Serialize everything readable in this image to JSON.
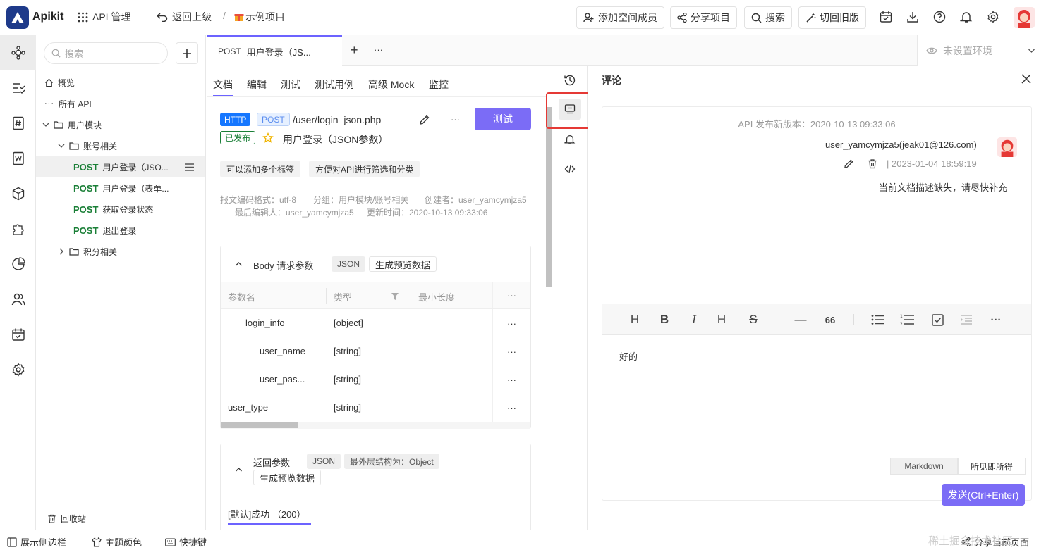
{
  "app": {
    "name": "Apikit",
    "api_manage": "API 管理",
    "back": "返回上级",
    "separator": "/",
    "project": "示例项目"
  },
  "top_actions": {
    "add_member": "添加空间成员",
    "share_project": "分享项目",
    "search": "搜索",
    "switch_old": "切回旧版"
  },
  "sidebar": {
    "search_placeholder": "搜索",
    "overview": "概览",
    "all_api": "所有 API",
    "user_module": "用户模块",
    "account": "账号相关",
    "apis": [
      {
        "method": "POST",
        "name": "用户登录（JSO..."
      },
      {
        "method": "POST",
        "name": "用户登录（表单..."
      },
      {
        "method": "POST",
        "name": "获取登录状态"
      },
      {
        "method": "POST",
        "name": "退出登录"
      }
    ],
    "points": "积分相关",
    "recycle": "回收站"
  },
  "bottom": {
    "show_sidebar": "展示侧边栏",
    "theme": "主题颜色",
    "shortcuts": "快捷键",
    "share_page": "分享当前页面"
  },
  "watermark": "稀土掘金技术社区",
  "tab": {
    "method": "POST",
    "title": "用户登录（JS...",
    "add": "+",
    "more": "···"
  },
  "env": {
    "label": "未设置环境"
  },
  "doc": {
    "subtabs": [
      "文档",
      "编辑",
      "测试",
      "测试用例",
      "高级 Mock",
      "监控"
    ],
    "protocol": "HTTP",
    "method": "POST",
    "path": "/user/login_json.php",
    "test_button": "测试",
    "status": "已发布",
    "name": "用户登录（JSON参数）",
    "tags": [
      "可以添加多个标签",
      "方便对API进行筛选和分类"
    ],
    "meta": {
      "encoding": "报文编码格式：utf-8",
      "group": "分组：用户模块/账号相关",
      "creator": "创建者：user_yamcymjza5",
      "editor": "最后编辑人：user_yamcymjza5",
      "updated": "更新时间：2020-10-13 09:33:06"
    },
    "body": {
      "title": "Body 请求参数",
      "type": "JSON",
      "preview": "生成预览数据",
      "headers": [
        "参数名",
        "类型",
        "最小长度"
      ],
      "rows": [
        {
          "name": "login_info",
          "type": "[object]"
        },
        {
          "name": "user_name",
          "type": "[string]"
        },
        {
          "name": "user_pas...",
          "type": "[string]"
        },
        {
          "name": "user_type",
          "type": "[string]"
        }
      ]
    },
    "response": {
      "title": "返回参数",
      "type": "JSON",
      "structure": "最外层结构为：Object",
      "preview": "生成预览数据",
      "tab": "[默认]成功 （200）"
    }
  },
  "comments": {
    "title": "评论",
    "version_note": "API 发布新版本：2020-10-13 09:33:06",
    "author": "user_yamcymjza5(jeak01@126.com)",
    "time": "| 2023-01-04 18:59:19",
    "text": "当前文档描述缺失，请尽快补充",
    "draft": "好的",
    "mode_markdown": "Markdown",
    "mode_wysiwyg": "所见即所得",
    "send": "发送(Ctrl+Enter)"
  },
  "colors": {
    "accent": "#6c63ff",
    "post": "#1a7f37",
    "http": "#1677ff",
    "highlight": "#e53935"
  }
}
